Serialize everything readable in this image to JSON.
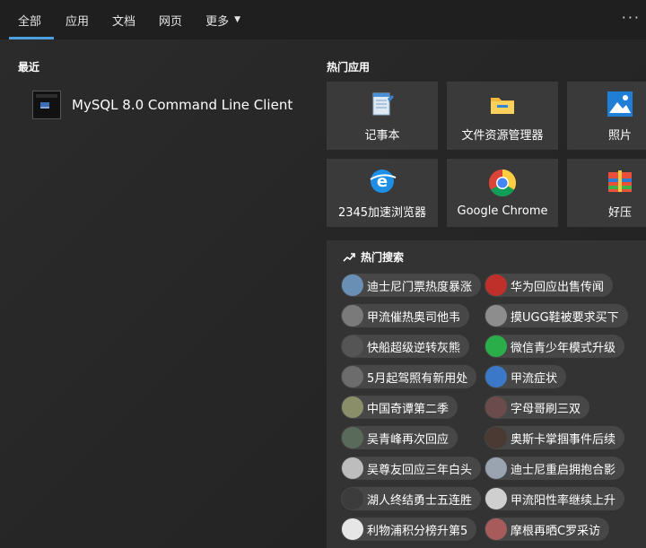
{
  "nav": {
    "tabs": [
      {
        "label": "全部",
        "active": true
      },
      {
        "label": "应用"
      },
      {
        "label": "文档"
      },
      {
        "label": "网页"
      },
      {
        "label": "更多"
      }
    ],
    "more_menu_icon": "ellipsis-icon"
  },
  "recent": {
    "title": "最近",
    "items": [
      {
        "label": "MySQL 8.0 Command Line Client",
        "icon": "terminal-icon"
      }
    ]
  },
  "hot_apps": {
    "title": "热门应用",
    "items": [
      {
        "label": "记事本",
        "icon": "notepad-icon"
      },
      {
        "label": "文件资源管理器",
        "icon": "folder-icon"
      },
      {
        "label": "照片",
        "icon": "photos-icon"
      },
      {
        "label": "2345加速浏览器",
        "icon": "browser-2345-icon"
      },
      {
        "label": "Google Chrome",
        "icon": "chrome-icon"
      },
      {
        "label": "好压",
        "icon": "haozip-icon"
      }
    ]
  },
  "hot_search": {
    "title": "热门搜索",
    "items": [
      {
        "label": "迪士尼门票热度暴涨",
        "avatar_color": "#6a8fb5"
      },
      {
        "label": "华为回应出售传闻",
        "avatar_color": "#c0302a"
      },
      {
        "label": "甲流催热奥司他韦",
        "avatar_color": "#7a7a7a"
      },
      {
        "label": "摸UGG鞋被要求买下",
        "avatar_color": "#8d8d8d"
      },
      {
        "label": "快船超级逆转灰熊",
        "avatar_color": "#555555"
      },
      {
        "label": "微信青少年模式升级",
        "avatar_color": "#2aae4a"
      },
      {
        "label": "5月起驾照有新用处",
        "avatar_color": "#6c6c6c"
      },
      {
        "label": "甲流症状",
        "avatar_color": "#3b78c8"
      },
      {
        "label": "中国奇谭第二季",
        "avatar_color": "#8a8f6a"
      },
      {
        "label": "字母哥刷三双",
        "avatar_color": "#6b4b4b"
      },
      {
        "label": "吴青峰再次回应",
        "avatar_color": "#5a6a5a"
      },
      {
        "label": "奥斯卡掌掴事件后续",
        "avatar_color": "#4a3a33"
      },
      {
        "label": "吴尊友回应三年白头",
        "avatar_color": "#bdbdbd"
      },
      {
        "label": "迪士尼重启拥抱合影",
        "avatar_color": "#9aa4b0"
      },
      {
        "label": "湖人终结勇士五连胜",
        "avatar_color": "#3c3c3c"
      },
      {
        "label": "甲流阳性率继续上升",
        "avatar_color": "#cfcfcf"
      },
      {
        "label": "利物浦积分榜升第5",
        "avatar_color": "#e6e6e6"
      },
      {
        "label": "摩根再晒C罗采访",
        "avatar_color": "#a85b5b"
      }
    ]
  }
}
